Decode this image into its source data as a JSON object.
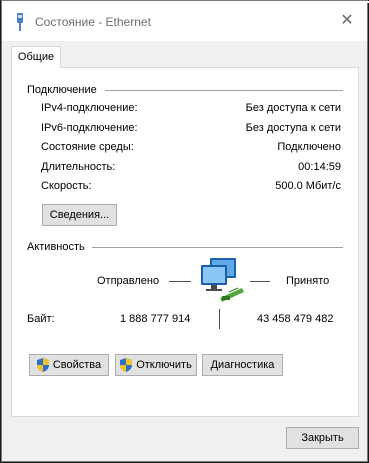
{
  "window": {
    "title": "Состояние - Ethernet",
    "close_glyph": "✕"
  },
  "tab": {
    "label": "Общие"
  },
  "connection": {
    "header": "Подключение",
    "rows": [
      {
        "label": "IPv4-подключение:",
        "value": "Без доступа к сети"
      },
      {
        "label": "IPv6-подключение:",
        "value": "Без доступа к сети"
      },
      {
        "label": "Состояние среды:",
        "value": "Подключено"
      },
      {
        "label": "Длительность:",
        "value": "00:14:59"
      },
      {
        "label": "Скорость:",
        "value": "500.0 Мбит/с"
      }
    ],
    "details_button": "Сведения..."
  },
  "activity": {
    "header": "Активность",
    "sent_label": "Отправлено",
    "received_label": "Принято",
    "bytes_label": "Байт:",
    "bytes_sent": "1 888 777 914",
    "bytes_received": "43 458 479 482",
    "icon": "network-computers-icon"
  },
  "buttons": {
    "properties": "Свойства",
    "disable": "Отключить",
    "diagnose": "Диагностика",
    "close": "Закрыть"
  }
}
